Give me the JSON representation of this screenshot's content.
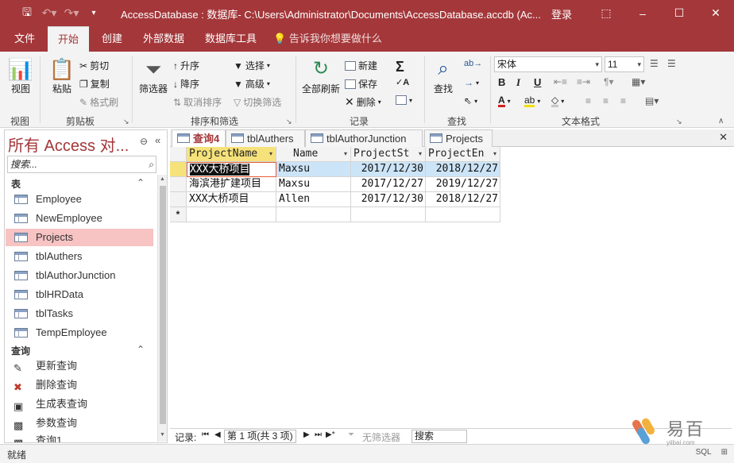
{
  "titlebar": {
    "title": "AccessDatabase : 数据库- C:\\Users\\Administrator\\Documents\\AccessDatabase.accdb (Ac...",
    "login": "登录",
    "qa_icons": [
      "save-icon",
      "undo-icon",
      "redo-icon",
      "customize-icon"
    ]
  },
  "ribbon_tabs": {
    "file": "文件",
    "home": "开始",
    "create": "创建",
    "external": "外部数据",
    "dbtools": "数据库工具",
    "tellme": "告诉我你想要做什么"
  },
  "ribbon": {
    "views": {
      "view": "视图",
      "group": "视图"
    },
    "clipboard": {
      "paste": "粘贴",
      "cut": "剪切",
      "copy": "复制",
      "format_painter": "格式刷",
      "group": "剪贴板"
    },
    "sort": {
      "filter": "筛选器",
      "asc": "升序",
      "desc": "降序",
      "remove_sort": "取消排序",
      "selection": "选择",
      "advanced": "高级",
      "toggle_filter": "切换筛选",
      "group": "排序和筛选"
    },
    "records": {
      "refresh_all": "全部刷新",
      "new": "新建",
      "save": "保存",
      "delete": "删除",
      "group": "记录"
    },
    "find": {
      "find": "查找",
      "group": "查找"
    },
    "text_format": {
      "font": "宋体",
      "size": "11",
      "bold": "B",
      "italic": "I",
      "underline": "U",
      "group": "文本格式"
    }
  },
  "nav": {
    "title": "所有 Access 对...",
    "search_placeholder": "搜索...",
    "tables_header": "表",
    "tables": [
      "Employee",
      "NewEmployee",
      "Projects",
      "tblAuthers",
      "tblAuthorJunction",
      "tblHRData",
      "tblTasks",
      "TempEmployee"
    ],
    "selected_table": "Projects",
    "queries_header": "查询",
    "queries": [
      "更新查询",
      "删除查询",
      "生成表查询",
      "参数查询",
      "查询1"
    ]
  },
  "doc_tabs": [
    "查询4",
    "tblAuthers",
    "tblAuthorJunction",
    "Projects"
  ],
  "datasheet": {
    "headers": [
      "ProjectName",
      "Name",
      "ProjectSt",
      "ProjectEn"
    ],
    "rows": [
      [
        "XXX大桥项目",
        "Maxsu",
        "2017/12/30",
        "2018/12/27"
      ],
      [
        "海滨港扩建项目",
        "Maxsu",
        "2017/12/27",
        "2019/12/27"
      ],
      [
        "XXX大桥项目",
        "Allen",
        "2017/12/30",
        "2018/12/27"
      ]
    ],
    "new_row_marker": "*"
  },
  "record_nav": {
    "label": "记录:",
    "position": "第 1 项(共 3 项)",
    "filter": "无筛选器",
    "search": "搜索"
  },
  "status": {
    "text": "就绪",
    "right": [
      "SQL",
      "⊞"
    ]
  },
  "watermark": {
    "text": "易百",
    "sub": "yiibai.com"
  },
  "colors": {
    "accent": "#a4373a",
    "selected_nav": "#f7c3c3",
    "selected_row": "#cce4f7",
    "header_sel": "#f6e27a"
  }
}
